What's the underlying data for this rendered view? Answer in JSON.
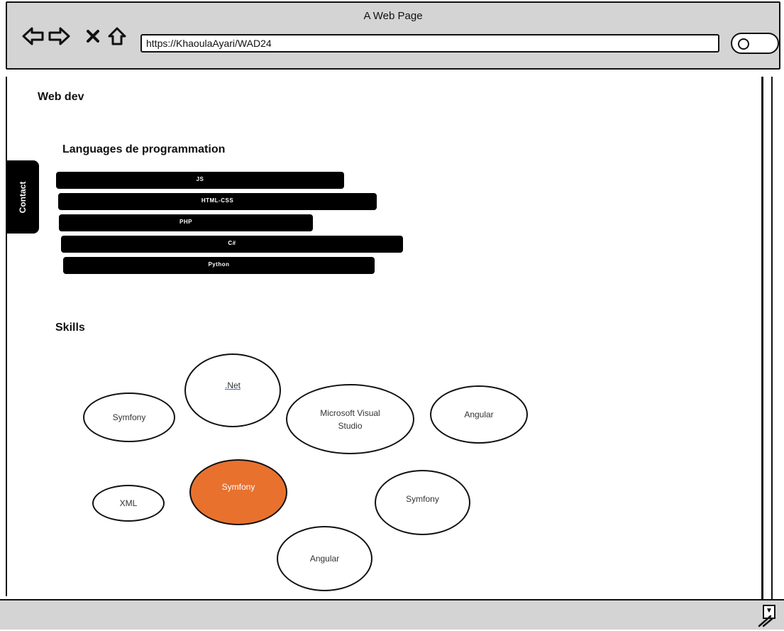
{
  "browser": {
    "window_title": "A Web Page",
    "url": "https://KhaoulaAyari/WAD24"
  },
  "site": {
    "title": "Web dev",
    "contact_tab": "Contact"
  },
  "languages": {
    "heading": "Languages de programmation",
    "items": [
      "JS",
      "HTML-CSS",
      "PHP",
      "C#",
      "Python"
    ]
  },
  "skills": {
    "heading": "Skills",
    "items": [
      ".Net",
      "Symfony",
      "Microsoft Visual Studio",
      "Angular",
      "Symfony",
      "XML",
      "Symfony",
      "Angular"
    ],
    "highlight_color": "#e8712e"
  },
  "icons": [
    "back-arrow-icon",
    "forward-arrow-icon",
    "close-icon",
    "home-icon",
    "search-icon"
  ]
}
